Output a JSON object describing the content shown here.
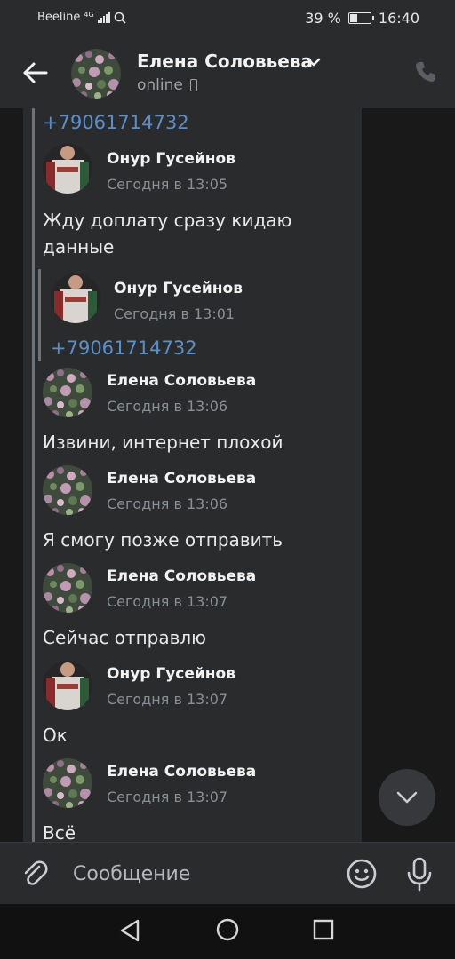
{
  "status_bar": {
    "carrier": "Beeline",
    "network": "4G",
    "battery": "39 %",
    "time": "16:40"
  },
  "header": {
    "name": "Елена Соловьева",
    "status": "online",
    "icons": {
      "back": "back-arrow-icon",
      "dropdown": "chevron-down-icon",
      "status": "mobile-phone-icon",
      "call": "phone-call-icon"
    }
  },
  "messages": [
    {
      "type": "forward-tail",
      "text": "+79061714732"
    },
    {
      "author": "Онур Гусейнов",
      "time": "Сегодня в 13:05",
      "text": "Жду доплату сразу кидаю\nданные",
      "forwarded": {
        "author": "Онур Гусейнов",
        "time": "Сегодня в 13:01",
        "text": "+79061714732"
      }
    },
    {
      "author": "Елена Соловьева",
      "time": "Сегодня в 13:06",
      "text": "Извини, интернет плохой"
    },
    {
      "author": "Елена Соловьева",
      "time": "Сегодня в 13:06",
      "text": "Я смогу позже отправить"
    },
    {
      "author": "Елена Соловьева",
      "time": "Сегодня в 13:07",
      "text": "Сейчас отправлю"
    },
    {
      "author": "Онур Гусейнов",
      "time": "Сегодня в 13:07",
      "text": "Ок"
    },
    {
      "author": "Елена Соловьева",
      "time": "Сегодня в 13:07",
      "text": "Всё"
    }
  ],
  "composer": {
    "placeholder": "Сообщение",
    "icons": {
      "attach": "paperclip-icon",
      "emoji": "emoji-icon",
      "voice": "microphone-icon"
    }
  },
  "colors": {
    "background": "#19191a",
    "panel": "#2a2b2d",
    "link": "#5c8fc7",
    "muted": "#8a8f95"
  }
}
